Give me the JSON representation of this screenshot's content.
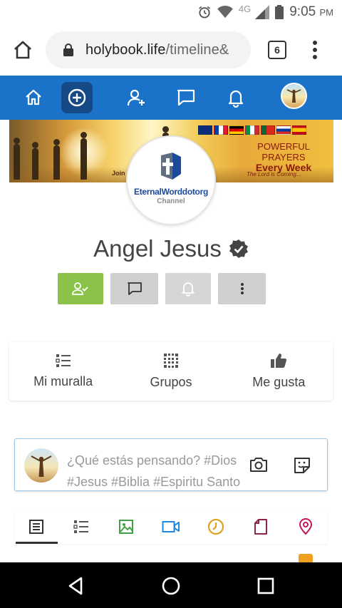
{
  "status_bar": {
    "network": "4G",
    "time": "9:05",
    "ampm": "PM"
  },
  "browser": {
    "url_domain": "holybook.life",
    "url_path": "/timeline&",
    "tab_count": "6"
  },
  "app_nav": {
    "items": [
      "home-icon",
      "add-circle-icon",
      "add-user-icon",
      "chat-icon",
      "bell-icon",
      "avatar"
    ],
    "accent": "#1a73c8"
  },
  "cover": {
    "join_text": "Join",
    "prayers_line1": "POWERFUL",
    "prayers_line2": "PRAYERS",
    "prayers_line3": "Every Week",
    "tagline": "The Lord is Coming..."
  },
  "logo": {
    "name": "EternalWorddotorg",
    "sub": "Channel"
  },
  "profile": {
    "name": "Angel Jesus"
  },
  "actions": {
    "accent_green": "#8bc34a"
  },
  "tabs": [
    {
      "label": "Mi muralla",
      "icon": "wall-list-icon"
    },
    {
      "label": "Grupos",
      "icon": "groups-grid-icon"
    },
    {
      "label": "Me gusta",
      "icon": "thumbs-up-icon"
    }
  ],
  "composer": {
    "placeholder": "¿Qué estás pensando? #Dios #Jesus #Biblia #Espiritu Santo"
  },
  "post_types": [
    {
      "icon": "text-post-icon",
      "color": "#333333"
    },
    {
      "icon": "list-post-icon",
      "color": "#555555"
    },
    {
      "icon": "image-icon",
      "color": "#43a047"
    },
    {
      "icon": "video-icon",
      "color": "#1e88e5"
    },
    {
      "icon": "clock-icon",
      "color": "#e0a020"
    },
    {
      "icon": "file-icon",
      "color": "#8e244d"
    },
    {
      "icon": "location-icon",
      "color": "#c2185b"
    }
  ]
}
